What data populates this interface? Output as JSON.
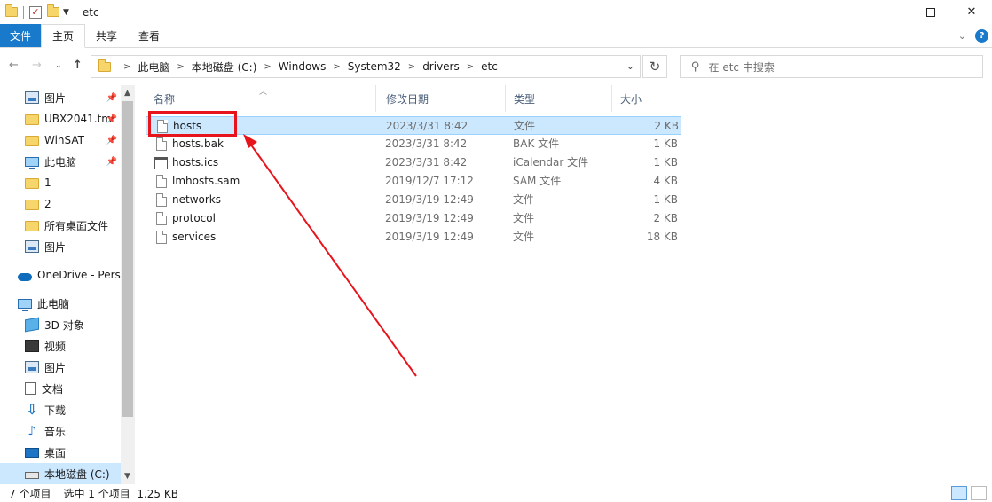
{
  "window": {
    "title": "etc"
  },
  "ribbon": {
    "tabs": [
      "文件",
      "主页",
      "共享",
      "查看"
    ]
  },
  "address": {
    "crumbs": [
      "此电脑",
      "本地磁盘 (C:)",
      "Windows",
      "System32",
      "drivers",
      "etc"
    ],
    "search_placeholder": "在 etc 中搜索"
  },
  "nav": {
    "items": [
      {
        "label": "图片",
        "icon": "picture-icon",
        "pinned": true
      },
      {
        "label": "UBX2041.tm",
        "icon": "folder-icon",
        "pinned": true
      },
      {
        "label": "WinSAT",
        "icon": "folder-icon",
        "pinned": true
      },
      {
        "label": "此电脑",
        "icon": "computer-icon",
        "pinned": true
      },
      {
        "label": "1",
        "icon": "folder-icon",
        "pinned": false
      },
      {
        "label": "2",
        "icon": "folder-icon",
        "pinned": false
      },
      {
        "label": "所有桌面文件",
        "icon": "folder-icon",
        "pinned": false
      },
      {
        "label": "图片",
        "icon": "picture-icon",
        "pinned": false
      },
      {
        "label": "OneDrive - Perso",
        "icon": "cloud-icon",
        "pinned": false
      },
      {
        "label": "此电脑",
        "icon": "computer-icon",
        "pinned": false
      },
      {
        "label": "3D 对象",
        "icon": "cube-icon",
        "pinned": false
      },
      {
        "label": "视频",
        "icon": "video-icon",
        "pinned": false
      },
      {
        "label": "图片",
        "icon": "picture-icon",
        "pinned": false
      },
      {
        "label": "文档",
        "icon": "document-icon",
        "pinned": false
      },
      {
        "label": "下载",
        "icon": "download-icon",
        "pinned": false
      },
      {
        "label": "音乐",
        "icon": "music-icon",
        "pinned": false
      },
      {
        "label": "桌面",
        "icon": "desktop-icon",
        "pinned": false
      },
      {
        "label": "本地磁盘 (C:)",
        "icon": "drive-icon",
        "pinned": false,
        "selected": true
      }
    ]
  },
  "columns": {
    "name": "名称",
    "date": "修改日期",
    "type": "类型",
    "size": "大小"
  },
  "files": [
    {
      "name": "hosts",
      "date": "2023/3/31 8:42",
      "type": "文件",
      "size": "2 KB",
      "selected": true
    },
    {
      "name": "hosts.bak",
      "date": "2023/3/31 8:42",
      "type": "BAK 文件",
      "size": "1 KB"
    },
    {
      "name": "hosts.ics",
      "date": "2023/3/31 8:42",
      "type": "iCalendar 文件",
      "size": "1 KB"
    },
    {
      "name": "lmhosts.sam",
      "date": "2019/12/7 17:12",
      "type": "SAM 文件",
      "size": "4 KB"
    },
    {
      "name": "networks",
      "date": "2019/3/19 12:49",
      "type": "文件",
      "size": "1 KB"
    },
    {
      "name": "protocol",
      "date": "2019/3/19 12:49",
      "type": "文件",
      "size": "2 KB"
    },
    {
      "name": "services",
      "date": "2019/3/19 12:49",
      "type": "文件",
      "size": "18 KB"
    }
  ],
  "status": {
    "count": "7 个项目",
    "selection": "选中 1 个项目  1.25 KB"
  },
  "colors": {
    "accent": "#1979ca",
    "selection": "#cce8ff",
    "annotation": "#e8141c"
  }
}
